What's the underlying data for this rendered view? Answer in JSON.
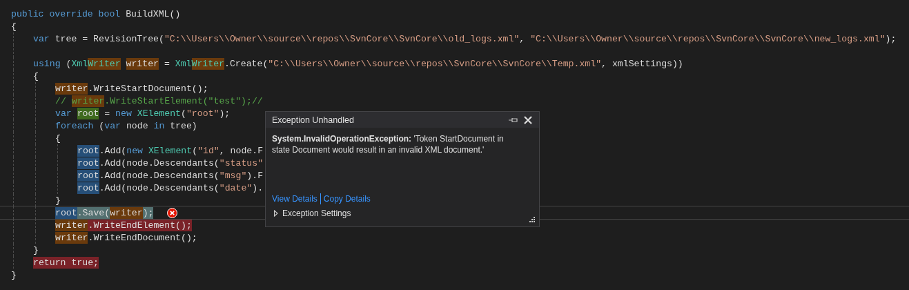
{
  "editor": {
    "lines": [
      {
        "tokens": [
          {
            "kind": "keyword",
            "text": "public override bool"
          },
          {
            "kind": "plain",
            "text": " BuildXML()"
          }
        ]
      },
      {
        "tokens": [
          {
            "kind": "plain",
            "text": "{"
          }
        ],
        "children": [
          {
            "tokens": [
              {
                "kind": "keyword",
                "text": "var"
              },
              {
                "kind": "plain",
                "text": " tree = RevisionTree("
              },
              {
                "kind": "string",
                "text": "\"C:\\\\Users\\\\Owner\\\\source\\\\repos\\\\SvnCore\\\\SvnCore\\\\old_logs.xml\""
              },
              {
                "kind": "plain",
                "text": ", "
              },
              {
                "kind": "string",
                "text": "\"C:\\\\Users\\\\Owner\\\\source\\\\repos\\\\SvnCore\\\\SvnCore\\\\new_logs.xml\""
              },
              {
                "kind": "plain",
                "text": ");"
              }
            ]
          },
          {
            "blank_line_before": true,
            "tokens": [
              {
                "kind": "keyword",
                "text": "using"
              },
              {
                "kind": "plain",
                "text": " ("
              },
              {
                "kind": "type",
                "text": "Xml"
              },
              {
                "kind": "type",
                "text": "Writer",
                "color": "#6a3a0c"
              },
              {
                "kind": "plain",
                "text": "writer",
                "color": "#6a3a0c",
                "space_before": true
              },
              {
                "kind": "plain",
                "text": " = "
              },
              {
                "kind": "type",
                "text": "Xml"
              },
              {
                "kind": "type",
                "text": "Writer",
                "color": "#6a3a0c"
              },
              {
                "kind": "plain",
                "text": ".Create("
              },
              {
                "kind": "string",
                "text": "\"C:\\\\Users\\\\Owner\\\\source\\\\repos\\\\SvnCore\\\\SvnCore\\\\Temp.xml\""
              },
              {
                "kind": "plain",
                "text": ", xmlSettings))"
              }
            ]
          },
          {
            "tokens": [
              {
                "kind": "plain",
                "text": "{"
              }
            ],
            "children": [
              {
                "tokens": [
                  {
                    "kind": "plain",
                    "text": "writer",
                    "color": "#6a3a0c"
                  },
                  {
                    "kind": "plain",
                    "text": ".WriteStartDocument();"
                  }
                ]
              },
              {
                "tokens": [
                  {
                    "kind": "comment",
                    "text": "//"
                  },
                  {
                    "kind": "comment",
                    "text": "writer",
                    "color": "#6a3a0c",
                    "space_before": true
                  },
                  {
                    "kind": "comment",
                    "text": ".WriteStartElement(\"test\");//"
                  }
                ]
              },
              {
                "tokens": [
                  {
                    "kind": "keyword",
                    "text": "var"
                  },
                  {
                    "kind": "plain",
                    "text": "root",
                    "color": "#3f6a1e",
                    "space_before": true
                  },
                  {
                    "kind": "plain",
                    "text": " = "
                  },
                  {
                    "kind": "keyword",
                    "text": "new"
                  },
                  {
                    "kind": "type",
                    "text": "XElement",
                    "space_before": true
                  },
                  {
                    "kind": "plain",
                    "text": "("
                  },
                  {
                    "kind": "string",
                    "text": "\"root\""
                  },
                  {
                    "kind": "plain",
                    "text": ");"
                  }
                ]
              },
              {
                "tokens": [
                  {
                    "kind": "keyword",
                    "text": "foreach"
                  },
                  {
                    "kind": "plain",
                    "text": " ("
                  },
                  {
                    "kind": "keyword",
                    "text": "var"
                  },
                  {
                    "kind": "plain",
                    "text": " node "
                  },
                  {
                    "kind": "keyword",
                    "text": "in"
                  },
                  {
                    "kind": "plain",
                    "text": " tree)"
                  }
                ]
              },
              {
                "tokens": [
                  {
                    "kind": "plain",
                    "text": "{"
                  }
                ],
                "children": [
                  {
                    "tokens": [
                      {
                        "kind": "plain",
                        "text": "root",
                        "color": "#264f78"
                      },
                      {
                        "kind": "plain",
                        "text": ".Add("
                      },
                      {
                        "kind": "keyword",
                        "text": "new"
                      },
                      {
                        "kind": "type",
                        "text": "XElement",
                        "space_before": true
                      },
                      {
                        "kind": "plain",
                        "text": "("
                      },
                      {
                        "kind": "string",
                        "text": "\"id\""
                      },
                      {
                        "kind": "plain",
                        "text": ", node.F"
                      }
                    ]
                  },
                  {
                    "tokens": [
                      {
                        "kind": "plain",
                        "text": "root",
                        "color": "#264f78"
                      },
                      {
                        "kind": "plain",
                        "text": ".Add(node.Descendants("
                      },
                      {
                        "kind": "string",
                        "text": "\"status\""
                      }
                    ]
                  },
                  {
                    "tokens": [
                      {
                        "kind": "plain",
                        "text": "root",
                        "color": "#264f78"
                      },
                      {
                        "kind": "plain",
                        "text": ".Add(node.Descendants("
                      },
                      {
                        "kind": "string",
                        "text": "\"msg\""
                      },
                      {
                        "kind": "plain",
                        "text": ").F"
                      }
                    ]
                  },
                  {
                    "tokens": [
                      {
                        "kind": "plain",
                        "text": "root",
                        "color": "#264f78"
                      },
                      {
                        "kind": "plain",
                        "text": ".Add(node.Descendants("
                      },
                      {
                        "kind": "string",
                        "text": "\"date\""
                      },
                      {
                        "kind": "plain",
                        "text": ")."
                      }
                    ]
                  }
                ]
              },
              {
                "tokens": [
                  {
                    "kind": "plain",
                    "text": "}"
                  }
                ]
              },
              {
                "current": true,
                "error": true,
                "tokens": [
                  {
                    "kind": "plain",
                    "text": "root",
                    "color": "#264f78"
                  },
                  {
                    "kind": "plain",
                    "text": ".Save(",
                    "color": "#537070"
                  },
                  {
                    "kind": "plain",
                    "text": "writer",
                    "color": "#6a3a0c"
                  },
                  {
                    "kind": "plain",
                    "text": ");",
                    "color": "#537070"
                  }
                ]
              },
              {
                "tokens": [
                  {
                    "kind": "plain",
                    "text": "writer",
                    "color": "#6a3a0c"
                  },
                  {
                    "kind": "plain",
                    "text": ".WriteEndElement();",
                    "color": "#7a2228"
                  }
                ]
              },
              {
                "tokens": [
                  {
                    "kind": "plain",
                    "text": "writer",
                    "color": "#6a3a0c"
                  },
                  {
                    "kind": "plain",
                    "text": ".WriteEndDocument();"
                  }
                ]
              }
            ]
          },
          {
            "tokens": [
              {
                "kind": "plain",
                "text": "}"
              }
            ]
          },
          {
            "tokens": [
              {
                "kind": "plain",
                "text": "return true;",
                "color": "#7a2228"
              }
            ]
          }
        ]
      },
      {
        "tokens": [
          {
            "kind": "plain",
            "text": "}"
          }
        ]
      }
    ]
  },
  "popup": {
    "title": "Exception Unhandled",
    "message": "**System.InvalidOperationException:** 'Token StartDocument in state Document would result in an invalid XML document.'",
    "links": [
      "View Details",
      "Copy Details"
    ],
    "settings": {
      "label": "Exception Settings",
      "expanded": false
    }
  }
}
